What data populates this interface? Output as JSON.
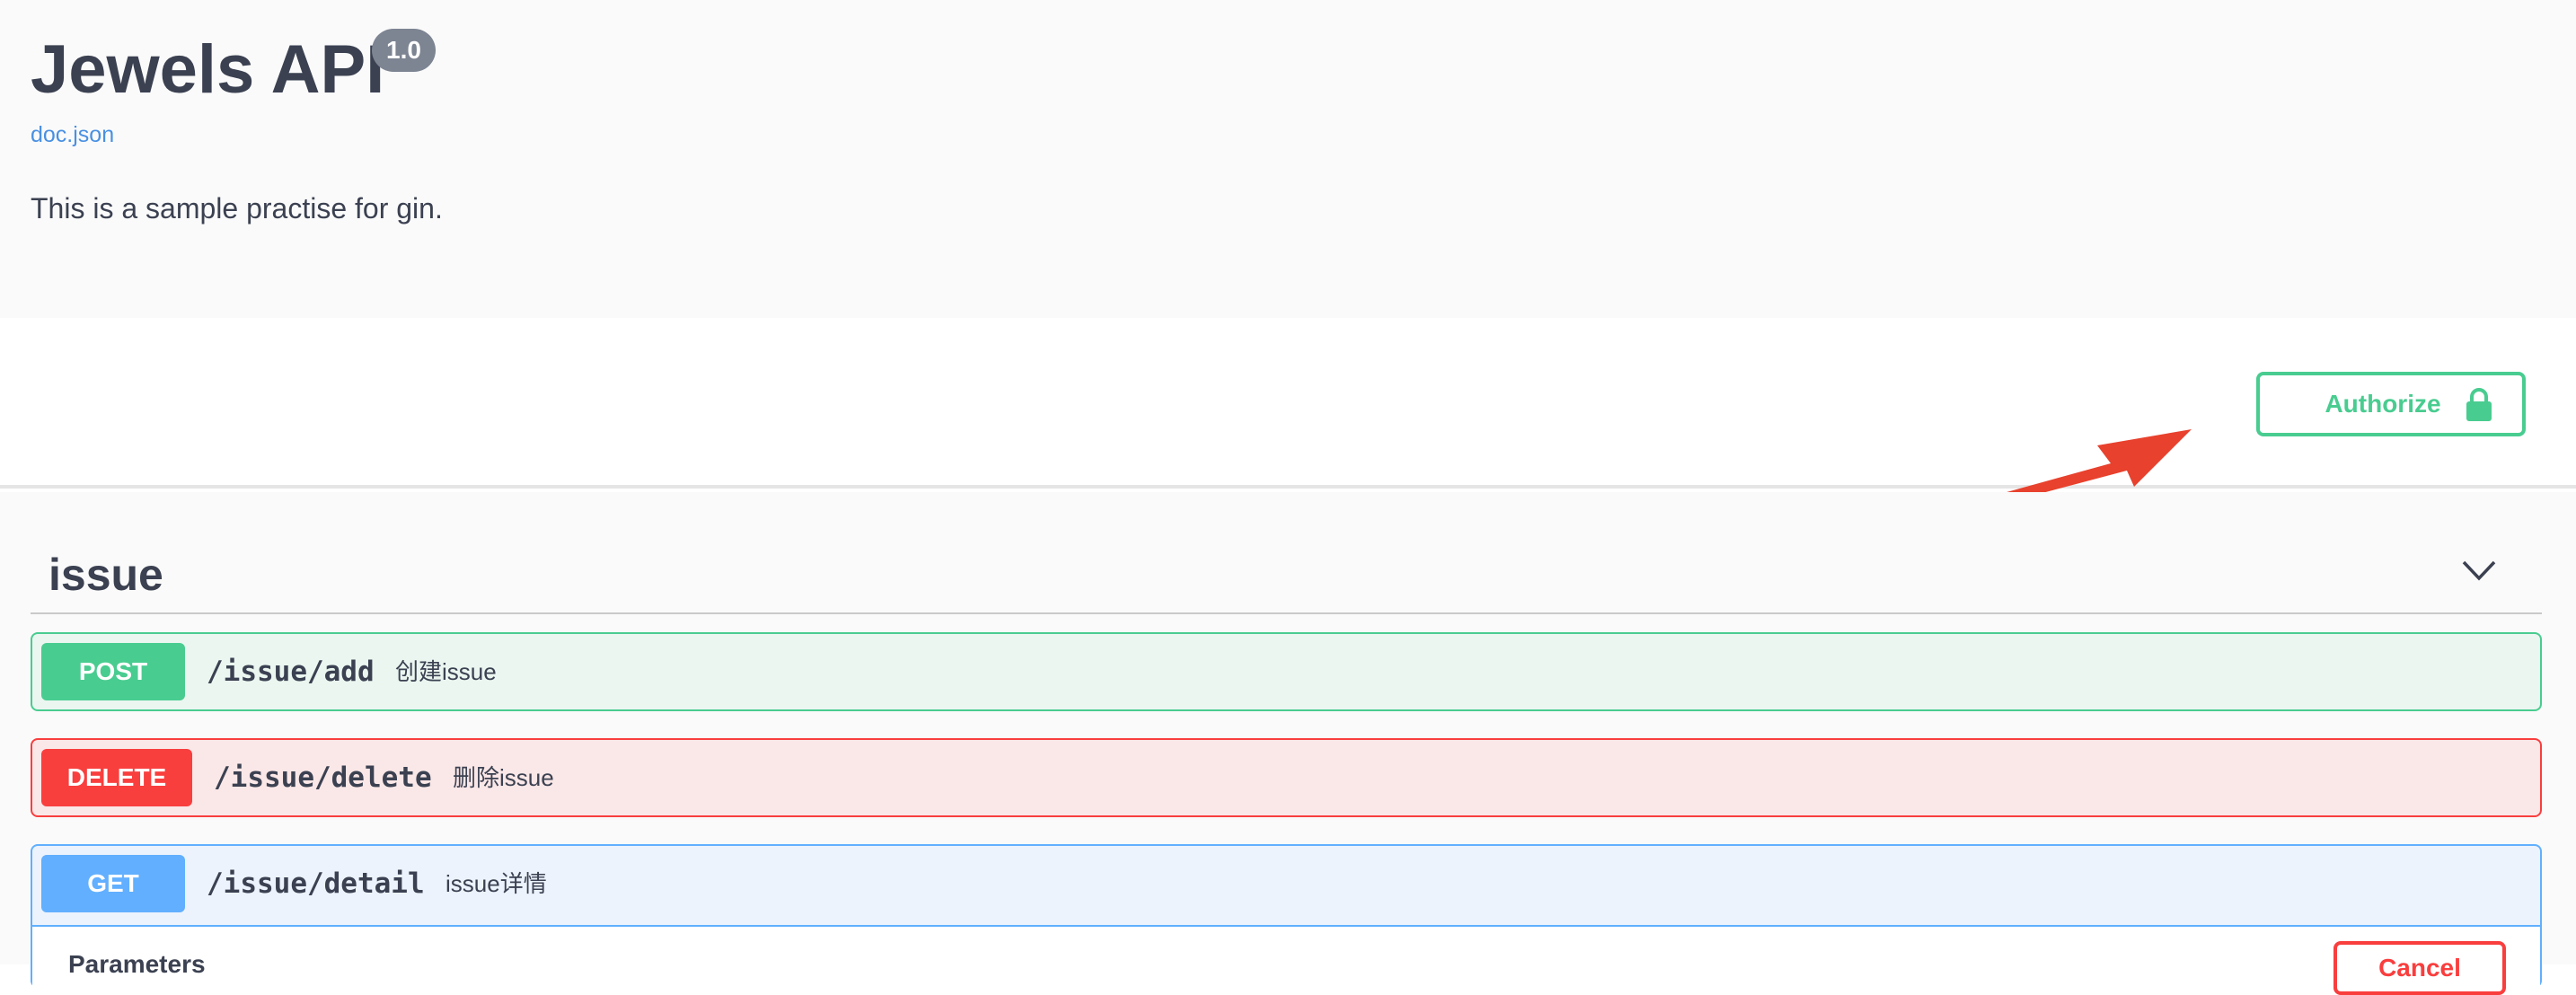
{
  "info": {
    "title": "Jewels API",
    "version": "1.0",
    "doc_link": "doc.json",
    "description": "This is a sample practise for gin."
  },
  "scheme": {
    "authorize_label": "Authorize"
  },
  "tag": {
    "name": "issue"
  },
  "operations": [
    {
      "method": "POST",
      "path": "/issue/add",
      "summary": "创建issue"
    },
    {
      "method": "DELETE",
      "path": "/issue/delete",
      "summary": "删除issue"
    },
    {
      "method": "GET",
      "path": "/issue/detail",
      "summary": "issue详情"
    }
  ],
  "expanded": {
    "parameters_label": "Parameters",
    "cancel_label": "Cancel"
  },
  "colors": {
    "post": "#49cc90",
    "delete": "#f93e3e",
    "get": "#61affe",
    "link": "#4990e2",
    "annotation_arrow": "#e8412d"
  },
  "icons": {
    "authorize": "lock-icon",
    "tag_toggle": "chevron-down-icon"
  }
}
